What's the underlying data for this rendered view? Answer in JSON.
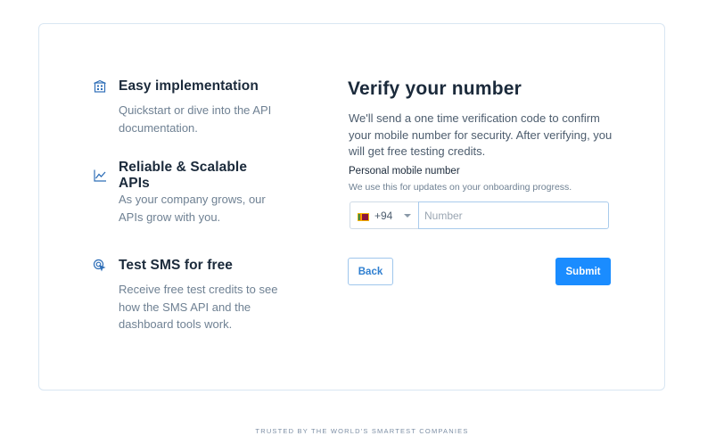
{
  "features": [
    {
      "icon": "building-icon",
      "title": "Easy implementation",
      "description": "Quickstart or dive into the API documentation."
    },
    {
      "icon": "chart-line-icon",
      "title": "Reliable & Scalable APIs",
      "description": "As your company grows, our APIs grow with you."
    },
    {
      "icon": "cursor-click-icon",
      "title": "Test SMS for free",
      "description": "Receive free test credits to see how the SMS API and the dashboard tools work."
    }
  ],
  "form": {
    "title": "Verify your number",
    "description": "We'll send a one time verification code to confirm your mobile number for security. After verifying, you will get free testing credits.",
    "field_label": "Personal mobile number",
    "field_hint": "We use this for updates on your onboarding progress.",
    "country_code": "+94",
    "country_flag": "sri-lanka-flag",
    "number_value": "",
    "number_placeholder": "Number",
    "back_label": "Back",
    "submit_label": "Submit"
  },
  "footer": {
    "trusted_text": "TRUSTED BY THE WORLD'S SMARTEST COMPANIES"
  },
  "colors": {
    "accent": "#1a8cff",
    "border": "#d9e6f2",
    "icon": "#2f6fb8"
  }
}
